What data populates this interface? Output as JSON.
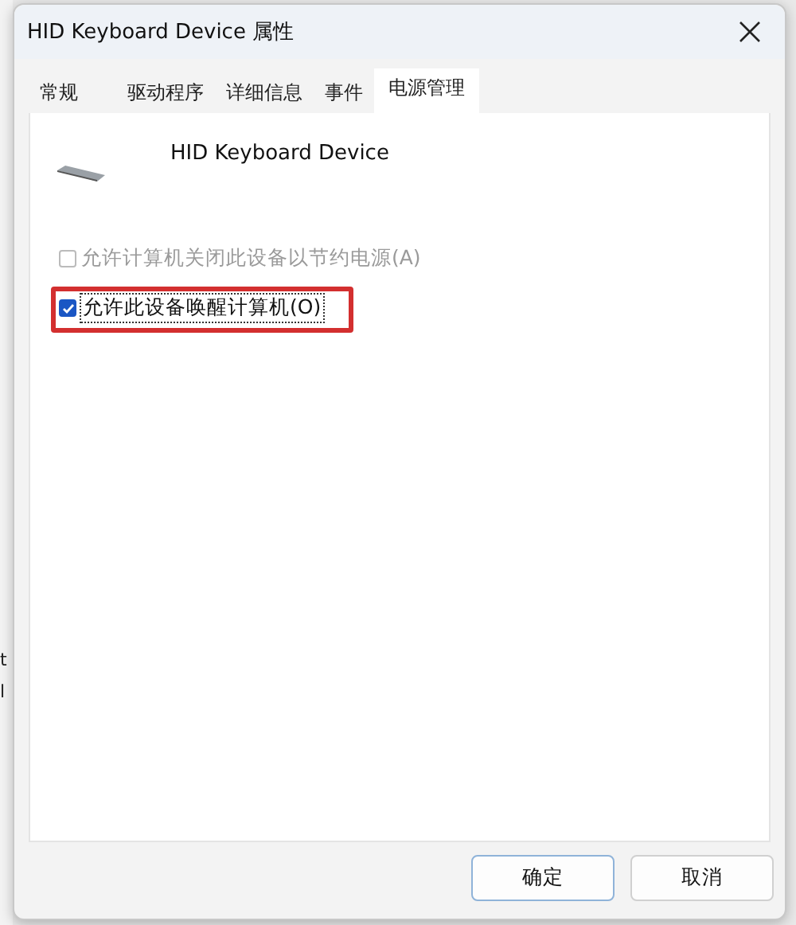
{
  "background_window": {
    "texts": [
      "t",
      "l"
    ]
  },
  "window": {
    "title": "HID Keyboard Device 属性"
  },
  "tabs": [
    {
      "label": "常规",
      "selected": false
    },
    {
      "label": "驱动程序",
      "selected": false
    },
    {
      "label": "详细信息",
      "selected": false
    },
    {
      "label": "事件",
      "selected": false
    },
    {
      "label": "电源管理",
      "selected": true
    }
  ],
  "device": {
    "name": "HID Keyboard Device"
  },
  "options": [
    {
      "label": "允许计算机关闭此设备以节约电源(A)",
      "checked": false,
      "disabled": true,
      "highlighted": false
    },
    {
      "label": "允许此设备唤醒计算机(O)",
      "checked": true,
      "disabled": false,
      "highlighted": true
    }
  ],
  "buttons": [
    {
      "label": "确定",
      "kind": "default"
    },
    {
      "label": "取消",
      "kind": "normal"
    }
  ]
}
